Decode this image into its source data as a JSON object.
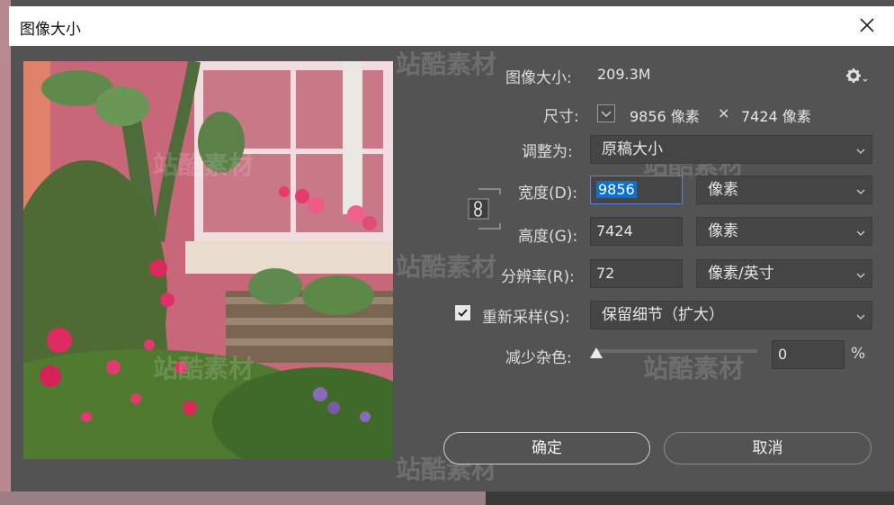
{
  "window": {
    "title": "图像大小"
  },
  "info": {
    "size_label": "图像大小:",
    "size_value": "209.3M",
    "dims_label": "尺寸:",
    "dims_width": "9856 像素",
    "dims_times": "×",
    "dims_height": "7424 像素"
  },
  "form": {
    "fit_label": "调整为:",
    "fit_value": "原稿大小",
    "width_label": "宽度(D):",
    "width_value": "9856",
    "width_unit": "像素",
    "height_label": "高度(G):",
    "height_value": "7424",
    "height_unit": "像素",
    "res_label": "分辨率(R):",
    "res_value": "72",
    "res_unit": "像素/英寸",
    "resample_label": "重新采样(S):",
    "resample_value": "保留细节（扩大）",
    "resample_checked": true,
    "noise_label": "减少杂色:",
    "noise_value": "0",
    "noise_unit": "%",
    "noise_level": 0
  },
  "buttons": {
    "ok": "确定",
    "cancel": "取消"
  },
  "watermark": "站酷素材",
  "colors": {
    "dialog": "#535353",
    "selection": "#0f6fd0",
    "field": "#454545"
  }
}
